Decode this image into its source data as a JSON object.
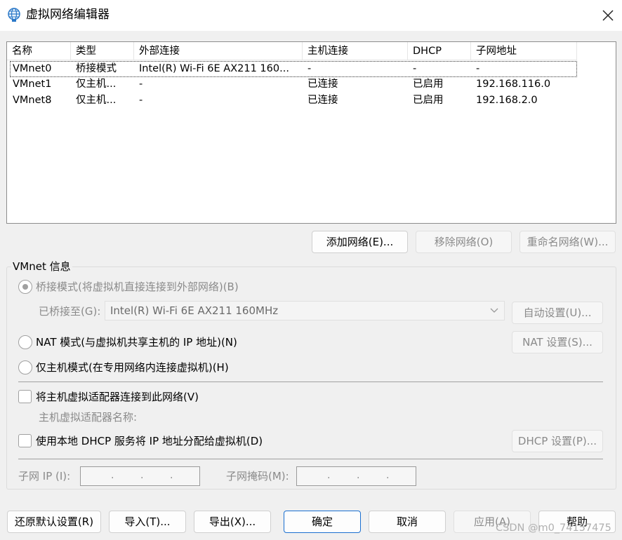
{
  "window": {
    "title": "虚拟网络编辑器",
    "icon": "globe-network-icon",
    "close_icon": "close-icon"
  },
  "list": {
    "columns": [
      "名称",
      "类型",
      "外部连接",
      "主机连接",
      "DHCP",
      "子网地址"
    ],
    "rows": [
      {
        "name": "VMnet0",
        "type": "桥接模式",
        "external": "Intel(R) Wi-Fi 6E AX211 160...",
        "host": "-",
        "dhcp": "-",
        "subnet": "-"
      },
      {
        "name": "VMnet1",
        "type": "仅主机...",
        "external": "-",
        "host": "已连接",
        "dhcp": "已启用",
        "subnet": "192.168.116.0"
      },
      {
        "name": "VMnet8",
        "type": "仅主机...",
        "external": "-",
        "host": "已连接",
        "dhcp": "已启用",
        "subnet": "192.168.2.0"
      }
    ]
  },
  "list_buttons": {
    "add": "添加网络(E)...",
    "remove": "移除网络(O)",
    "rename": "重命名网络(W)..."
  },
  "vmnet_info": {
    "title": "VMnet 信息",
    "bridged_label": "桥接模式(将虚拟机直接连接到外部网络)(B)",
    "bridged_to_label": "已桥接至(G):",
    "bridged_to_value": "Intel(R) Wi-Fi 6E AX211 160MHz",
    "auto_settings": "自动设置(U)...",
    "nat_label": "NAT 模式(与虚拟机共享主机的 IP 地址)(N)",
    "nat_settings": "NAT 设置(S)...",
    "hostonly_label": "仅主机模式(在专用网络内连接虚拟机)(H)",
    "connect_adapter_label": "将主机虚拟适配器连接到此网络(V)",
    "adapter_name_label": "主机虚拟适配器名称:",
    "dhcp_label": "使用本地 DHCP 服务将 IP 地址分配给虚拟机(D)",
    "dhcp_settings": "DHCP 设置(P)...",
    "subnet_ip_label": "子网 IP (I):",
    "subnet_mask_label": "子网掩码(M):",
    "ip_dots": "."
  },
  "footer": {
    "restore": "还原默认设置(R)",
    "import": "导入(T)...",
    "export": "导出(X)...",
    "ok": "确定",
    "cancel": "取消",
    "apply": "应用(A)",
    "help": "帮助"
  },
  "watermark": "CSDN @m0_74157475",
  "colors": {
    "window_bg": "#f0f0f0",
    "disabled_text": "#8a8a8a",
    "primary_border": "#1a6fd0"
  }
}
